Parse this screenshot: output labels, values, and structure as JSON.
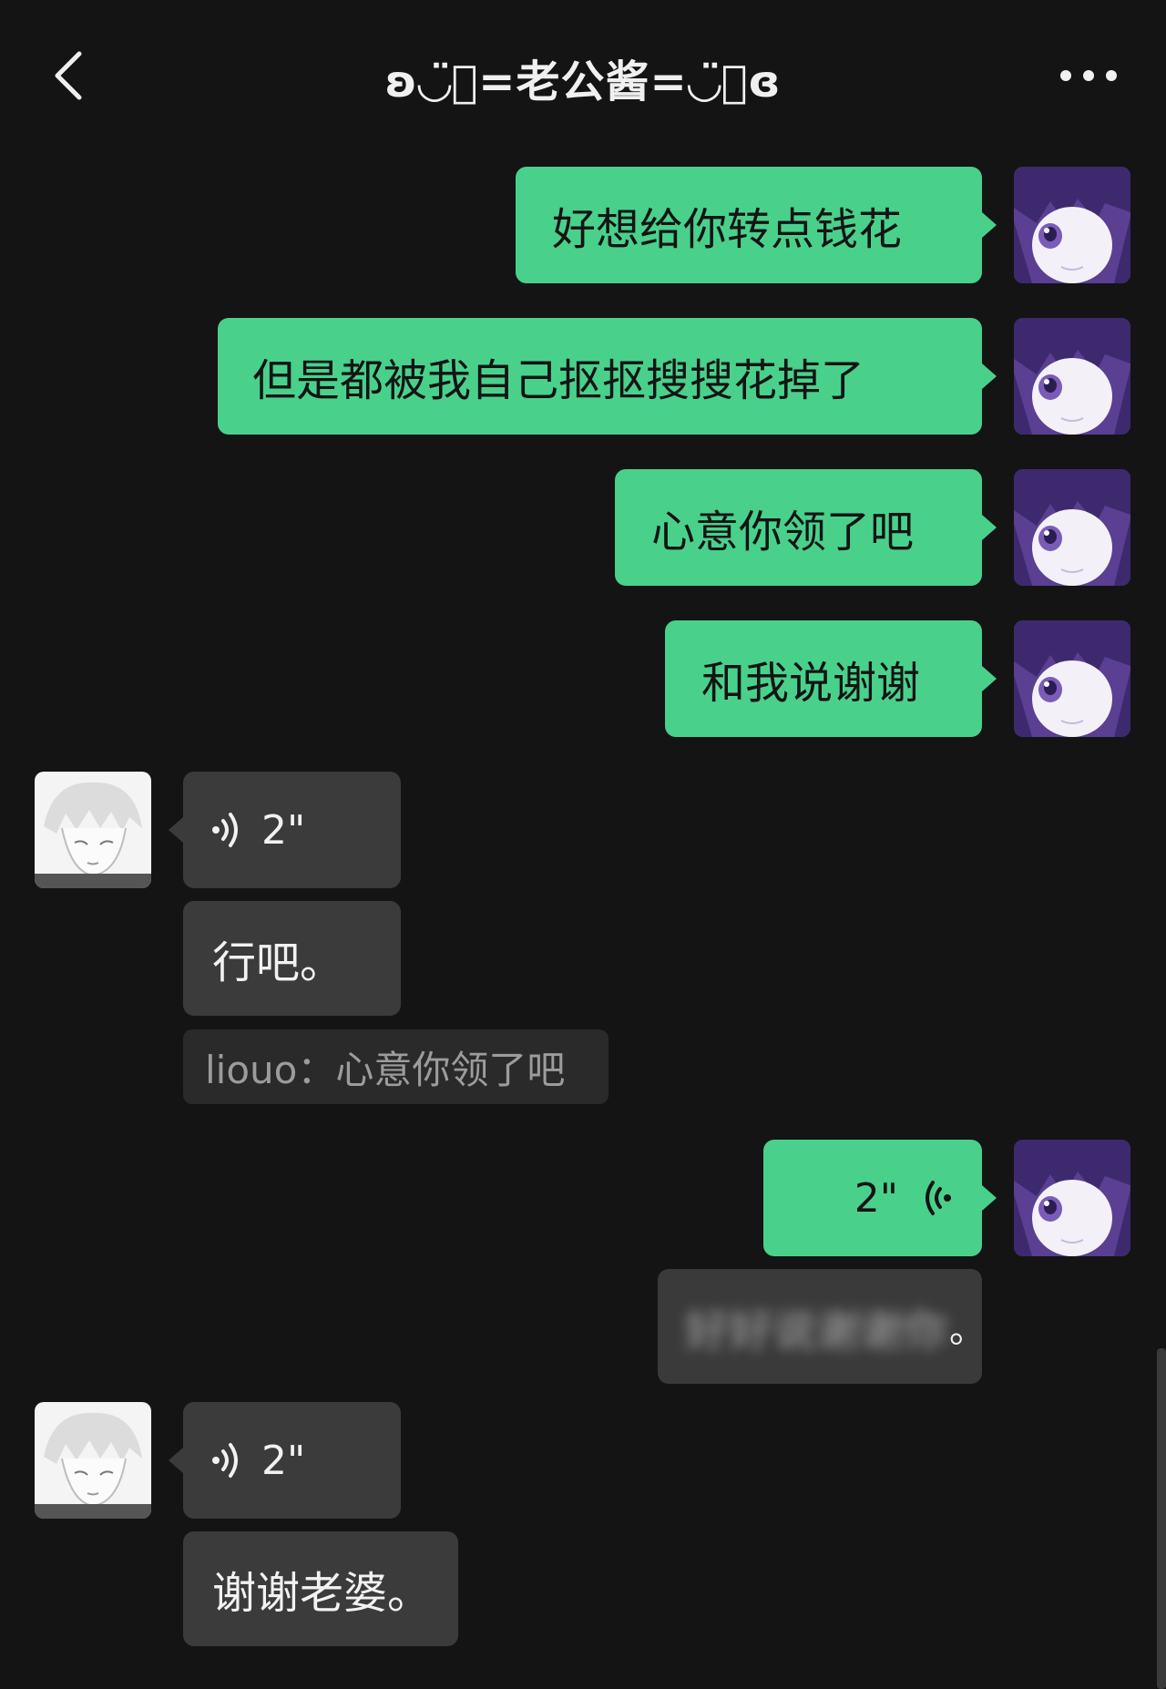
{
  "header": {
    "title": "ʚ◡̈⃝=老公酱=◡̈⃝ɞ"
  },
  "messages": {
    "m1": "好想给你转点钱花",
    "m2": "但是都被我自己抠抠搜搜花掉了",
    "m3": "心意你领了吧",
    "m4": "和我说谢谢",
    "v1": "2\"",
    "r1": "行吧。",
    "quote1": "liouo：心意你领了吧",
    "v2": "2\"",
    "blurred": "好好说谢谢你",
    "blurred_end": "。",
    "v3": "2\"",
    "r2": "谢谢老婆。"
  },
  "colors": {
    "background": "#141414",
    "self_bubble": "#49d18c",
    "other_bubble": "#3b3b3b",
    "quote_bg": "#2a2a2a"
  },
  "icons": {
    "back": "chevron-left-icon",
    "more": "more-dots-icon",
    "voice": "voice-wave-icon"
  }
}
